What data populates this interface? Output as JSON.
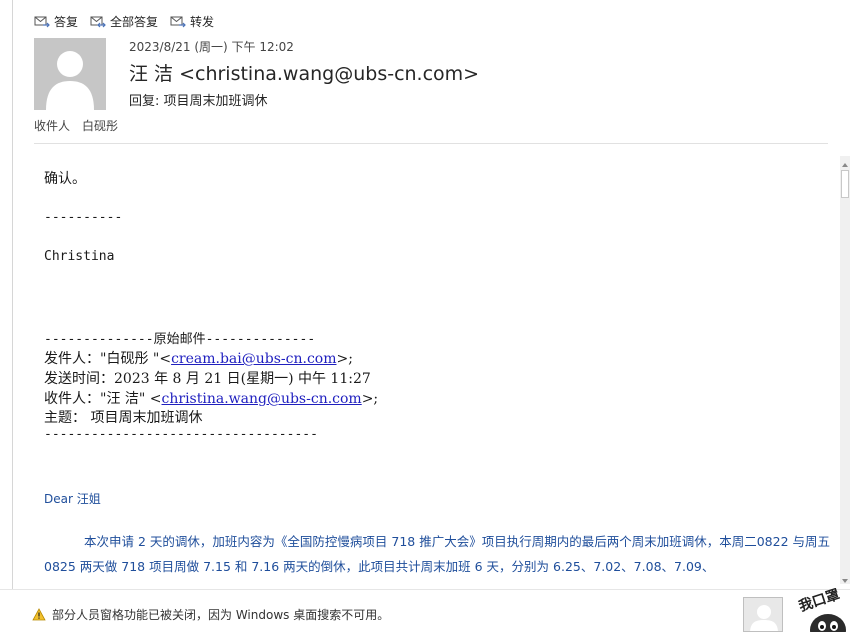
{
  "toolbar": {
    "reply": "答复",
    "reply_all": "全部答复",
    "forward": "转发"
  },
  "header": {
    "date": "2023/8/21 (周一) 下午 12:02",
    "from": "汪 洁 <christina.wang@ubs-cn.com>",
    "subject": "回复: 项目周末加班调休",
    "to_label": "收件人",
    "to_value": "白砚彤"
  },
  "body": {
    "line1": "确认。",
    "dashes1": "----------",
    "signature": "Christina",
    "orig_header": "--------------原始邮件--------------",
    "from_prefix": "发件人：\"白砚彤 \"<",
    "from_email": "cream.bai@ubs-cn.com",
    "from_suffix": ">;",
    "sent": "发送时间：2023 年 8 月 21 日(星期一) 中午 11:27",
    "to_prefix": "收件人：\"汪 洁\" <",
    "to_email": "christina.wang@ubs-cn.com",
    "to_suffix": ">;",
    "subject": "主题：  项目周末加班调休",
    "dashes2": "-----------------------------------",
    "dear": "Dear 汪姐",
    "paragraph": "本次申请 2 天的调休，加班内容为《全国防控慢病项目 718 推广大会》项目执行周期内的最后两个周末加班调休，本周二0822 与周五 0825 两天做 718 项目周做 7.15 和 7.16 两天的倒休，此项目共计周末加班 6 天，分别为 6.25、7.02、7.08、7.09、"
  },
  "status": {
    "message": "部分人员窗格功能已被关闭，因为 Windows 桌面搜索不可用。"
  },
  "sticker": {
    "text": "我口罩"
  }
}
